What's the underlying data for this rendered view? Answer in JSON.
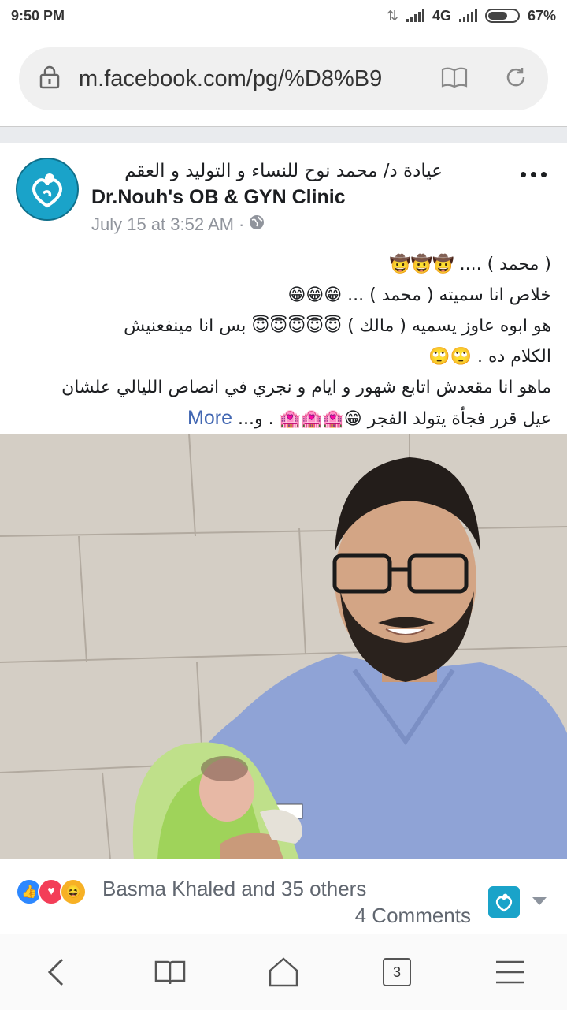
{
  "status_bar": {
    "time": "9:50 PM",
    "network": "4G",
    "battery": "67%",
    "battery_level": 0.67
  },
  "browser": {
    "url": "m.facebook.com/pg/%D8%B9",
    "open_tabs": "3"
  },
  "post": {
    "page_name_ar": "عيادة د/ محمد نوح للنساء و التوليد و العقم",
    "page_name_en": "Dr.Nouh's OB & GYN Clinic",
    "timestamp": "July 15 at 3:52 AM",
    "separator": "·",
    "text_lines": [
      {
        "text": "( محمد ) ....",
        "emoji": "🤠🤠🤠"
      },
      {
        "text": "خلاص انا سميته ( محمد ) ...",
        "emoji": "😁😁😁"
      },
      {
        "text": "هو ابوه عاوز يسميه ( مالك )",
        "emoji": "😇😇😇😇😇",
        "text_after": "بس انا مينفعنيش"
      },
      {
        "text": "الكلام ده .",
        "emoji": "🙄🙄"
      },
      {
        "text": "ماهو انا مقعدش اتابع شهور و ايام و نجري في انصاص الليالي علشان"
      },
      {
        "text": "عيل قرر فجأة يتولد الفجر",
        "emoji": "😁🏩🏩🏩",
        "text_after": ". و..."
      }
    ],
    "see_more": "More"
  },
  "reactions": {
    "summary": "Basma Khaled and 35 others",
    "comments": "4 Comments",
    "icons": [
      "like-icon",
      "love-icon",
      "haha-icon"
    ]
  },
  "colors": {
    "link": "#4267b2",
    "brand_avatar": "#1aa3c9",
    "muted": "#90949c"
  }
}
